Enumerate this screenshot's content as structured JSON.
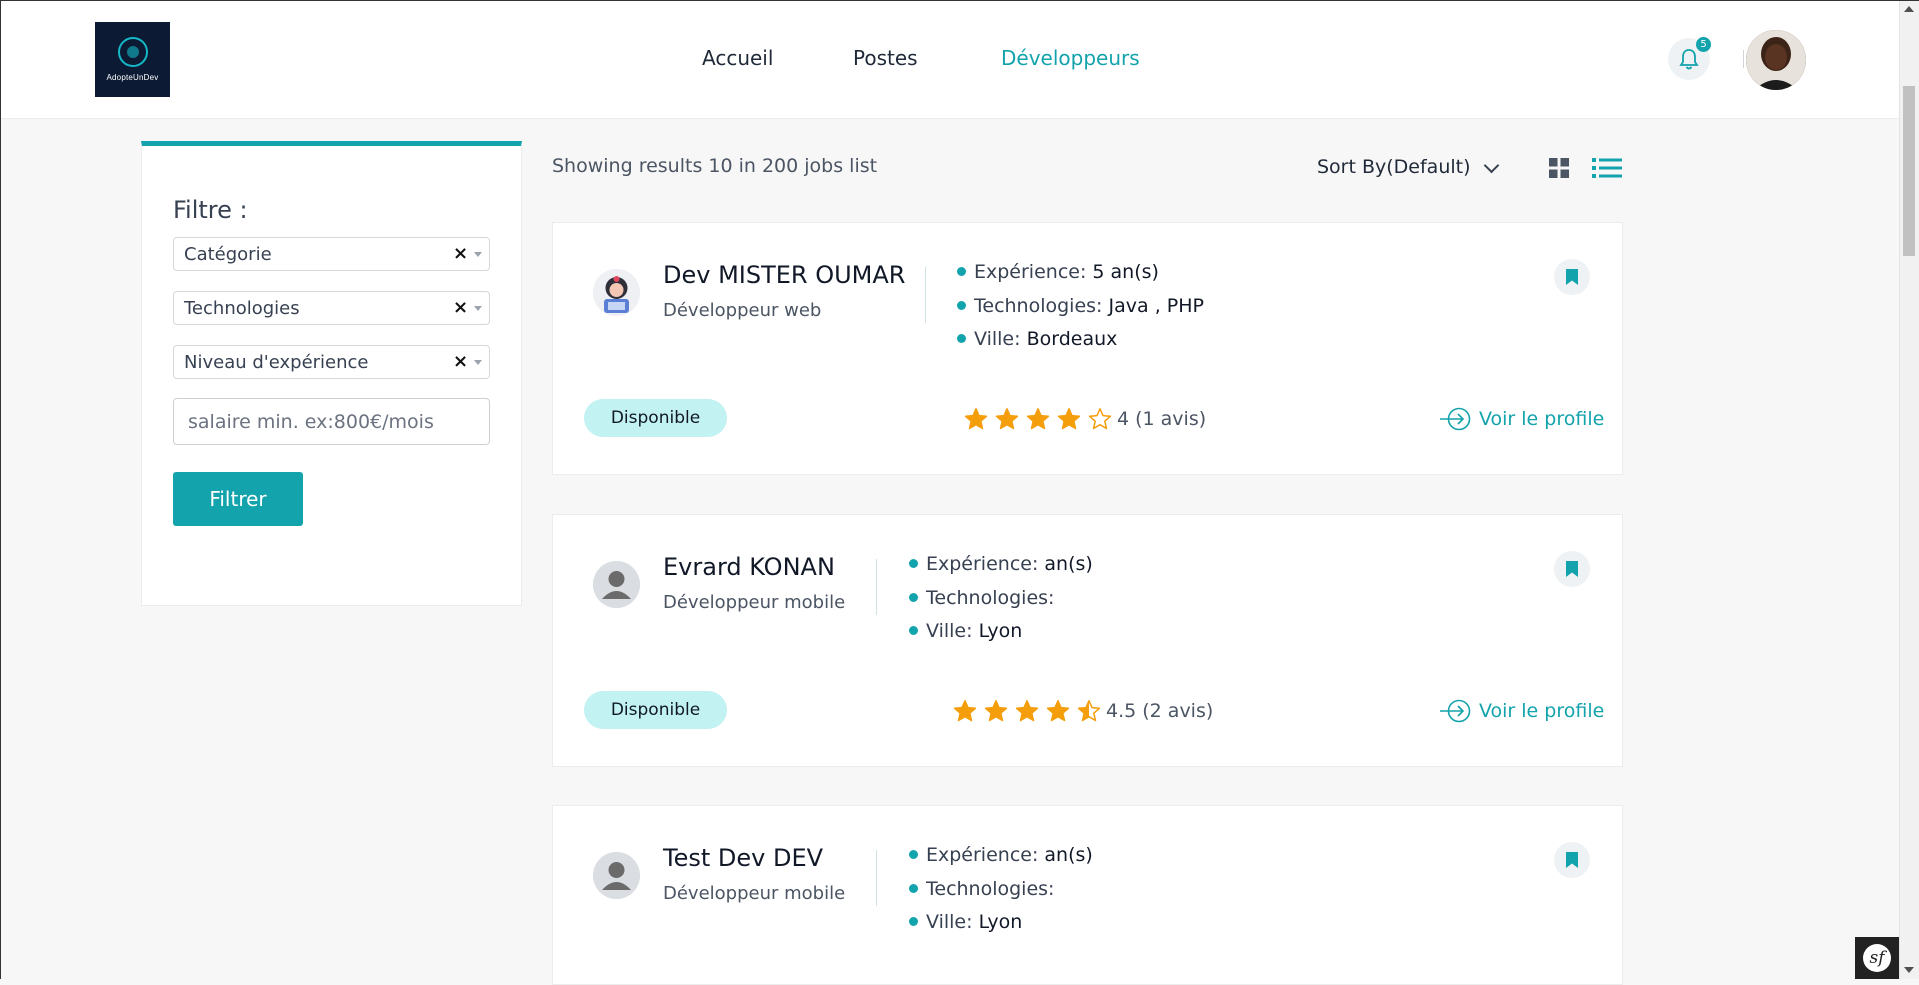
{
  "header": {
    "logo_text": "AdopteUnDev",
    "nav": [
      "Accueil",
      "Postes",
      "Développeurs"
    ],
    "notification_count": "5"
  },
  "filter": {
    "title": "Filtre :",
    "selects": [
      "Catégorie",
      "Technologies",
      "Niveau d'expérience"
    ],
    "clear_symbol": "×",
    "salary_placeholder": "salaire min. ex:800€/mois",
    "button_label": "Filtrer"
  },
  "listing": {
    "results_text": "Showing results 10 in 200 jobs list",
    "sort_label": "Sort By(Default)"
  },
  "labels": {
    "experience": "Expérience:",
    "technologies": "Technologies:",
    "ville": "Ville:",
    "voir_profile": "Voir le profile"
  },
  "developers": [
    {
      "name": "Dev MISTER OUMAR",
      "role": "Développeur web",
      "experience": "5 an(s)",
      "technologies": "Java , PHP",
      "ville": "Bordeaux",
      "status": "Disponible",
      "rating": 4,
      "rating_text": "4 (1 avis)"
    },
    {
      "name": "Evrard KONAN",
      "role": "Développeur mobile",
      "experience": "an(s)",
      "technologies": "",
      "ville": "Lyon",
      "status": "Disponible",
      "rating": 4.5,
      "rating_text": "4.5 (2 avis)"
    },
    {
      "name": "Test Dev DEV",
      "role": "Développeur mobile",
      "experience": "an(s)",
      "technologies": "",
      "ville": "Lyon"
    }
  ],
  "colors": {
    "accent": "#13a3ac",
    "star": "#f59e0b",
    "badge_bg": "#c2f2f2"
  },
  "icons": [
    "bell-icon",
    "bookmark-icon",
    "star-icon",
    "grid-view-icon",
    "list-view-icon",
    "arrow-circle-right-icon",
    "symfony-icon"
  ]
}
